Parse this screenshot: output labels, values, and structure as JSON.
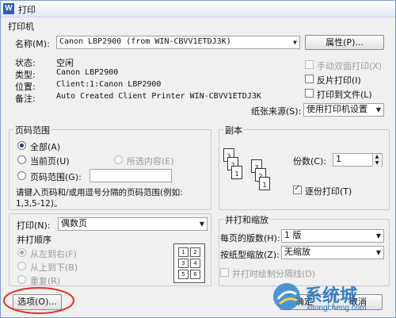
{
  "window": {
    "title": "打印",
    "app_icon": "W"
  },
  "printer": {
    "section_title": "打印机",
    "name_label": "名称(M):",
    "name_value": "Canon LBP2900 (from WIN-CBVV1ETDJ3K)",
    "properties_button": "属性(P)...",
    "status_label": "状态:",
    "status_value": "空闲",
    "type_label": "类型:",
    "type_value": "Canon LBP2900",
    "location_label": "位置:",
    "location_value": "Client:1:Canon LBP2900",
    "comment_label": "备注:",
    "comment_value": "Auto Created Client Printer WIN-CBVV1ETDJ3K",
    "manual_duplex": {
      "label": "手动双面打印(X)",
      "checked": false,
      "enabled": false
    },
    "reverse_print": {
      "label": "反片打印(I)",
      "checked": false
    },
    "print_to_file": {
      "label": "打印到文件(L)",
      "checked": false
    },
    "paper_source_label": "纸张来源(S):",
    "paper_source_value": "使用打印机设置"
  },
  "page_range": {
    "section_title": "页码范围",
    "all_label": "全部(A)",
    "current_label": "当前页(U)",
    "selection_label": "所选内容(E)",
    "pages_label": "页码范围(G):",
    "pages_value": "",
    "hint": "请键入页码和/或用逗号分隔的页码范围(例如:",
    "hint_example": "1,3,5-12)。"
  },
  "copies": {
    "section_title": "副本",
    "count_label": "份数(C):",
    "count_value": "1",
    "collate_label": "逐份打印(T)",
    "collate_checked": true,
    "page_numbers": [
      "3",
      "2",
      "1",
      "3",
      "2",
      "1"
    ]
  },
  "print_what": {
    "label": "打印(N):",
    "value": "偶数页",
    "order_title": "并打顺序",
    "left_to_right": "从左到右(F)",
    "top_to_bottom": "从上到下(B)",
    "repeat": "重复(R)",
    "order_grid": [
      "1",
      "2",
      "3",
      "4",
      "5",
      "6"
    ]
  },
  "zoom": {
    "section_title": "并打和缩放",
    "pages_per_sheet_label": "每页的版数(H):",
    "pages_per_sheet_value": "1 版",
    "scale_label": "按纸型缩放(Z):",
    "scale_value": "无缩放",
    "draw_borders_label": "并打时绘制分隔线(D)"
  },
  "footer": {
    "options_button": "选项(O)...",
    "ok_button": "确定",
    "cancel_button": "取消"
  },
  "watermark": {
    "brand": "系统城",
    "site": "xitongcheng.com"
  },
  "colors": {
    "highlight_circle": "#e0312c",
    "title_gradient_bottom": "#dfe8f5",
    "accent_icon": "#2c5fbb"
  }
}
